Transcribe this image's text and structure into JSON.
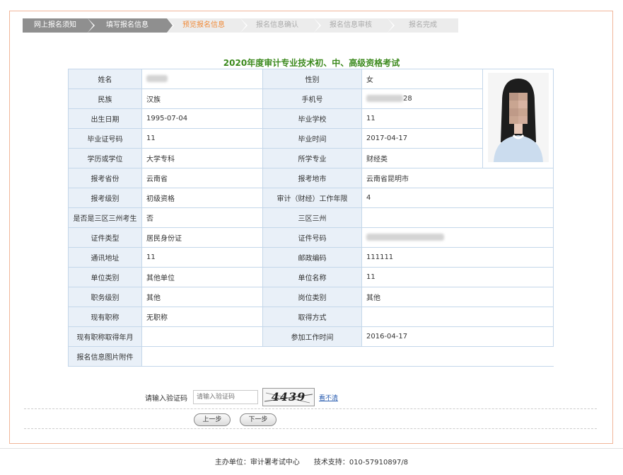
{
  "steps": [
    {
      "label": "网上报名须知",
      "state": "done"
    },
    {
      "label": "填写报名信息",
      "state": "done"
    },
    {
      "label": "预览报名信息",
      "state": "active"
    },
    {
      "label": "报名信息确认",
      "state": "todo"
    },
    {
      "label": "报名信息审核",
      "state": "todo"
    },
    {
      "label": "报名完成",
      "state": "todo"
    }
  ],
  "exam_title": "2020年度审计专业技术初、中、高级资格考试",
  "form": {
    "name_label": "姓名",
    "name_value": "",
    "gender_label": "性别",
    "gender_value": "女",
    "ethnicity_label": "民族",
    "ethnicity_value": "汉族",
    "phone_label": "手机号",
    "phone_value": "28",
    "birth_label": "出生日期",
    "birth_value": "1995-07-04",
    "school_label": "毕业学校",
    "school_value": "11",
    "cert_no_label": "毕业证号码",
    "cert_no_value": "11",
    "grad_time_label": "毕业时间",
    "grad_time_value": "2017-04-17",
    "degree_label": "学历或学位",
    "degree_value": "大学专科",
    "major_label": "所学专业",
    "major_value": "财经类",
    "province_label": "报考省份",
    "province_value": "云南省",
    "city_label": "报考地市",
    "city_value": "云南省昆明市",
    "level_label": "报考级别",
    "level_value": "初级资格",
    "work_years_label": "审计（财经）工作年限",
    "work_years_value": "4",
    "three_zone_q_label": "是否是三区三州考生",
    "three_zone_q_value": "否",
    "three_zone_label": "三区三州",
    "three_zone_value": "",
    "id_type_label": "证件类型",
    "id_type_value": "居民身份证",
    "id_no_label": "证件号码",
    "id_no_value": "",
    "address_label": "通讯地址",
    "address_value": "11",
    "postcode_label": "邮政编码",
    "postcode_value": "111111",
    "unit_type_label": "单位类别",
    "unit_type_value": "其他单位",
    "unit_name_label": "单位名称",
    "unit_name_value": "11",
    "duty_level_label": "职务级别",
    "duty_level_value": "其他",
    "post_type_label": "岗位类别",
    "post_type_value": "其他",
    "title_label": "现有职称",
    "title_value": "无职称",
    "obtain_label": "取得方式",
    "obtain_value": "",
    "title_year_label": "现有职称取得年月",
    "title_year_value": "",
    "work_start_label": "参加工作时间",
    "work_start_value": "2016-04-17",
    "attach_label": "报名信息图片附件",
    "attach_value": ""
  },
  "captcha": {
    "label": "请输入验证码",
    "placeholder": "请输入验证码",
    "image_text": "4439",
    "refresh_link": "看不清"
  },
  "buttons": {
    "prev": "上一步",
    "next": "下一步"
  },
  "footer": {
    "text": "主办单位：审计署考试中心　　技术支持：010-57910897/8"
  },
  "colors": {
    "title_green": "#3c8a1e",
    "active_step": "#f08b3a",
    "label_bg": "#e9f0f8",
    "border": "#c4d7ea",
    "frame": "#f1b69a"
  }
}
